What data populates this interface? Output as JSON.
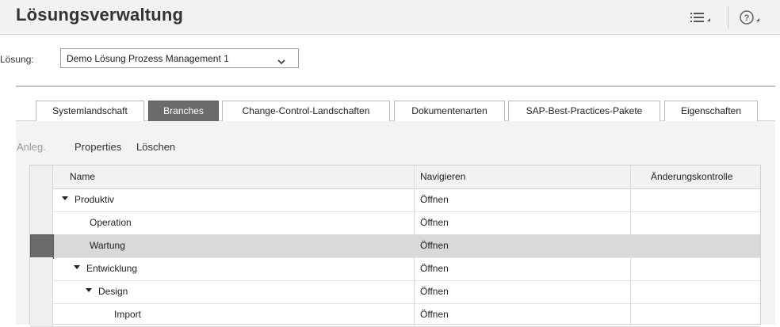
{
  "header": {
    "title": "Lösungsverwaltung"
  },
  "solution": {
    "label": "Lösung:",
    "selected": "Demo Lösung Prozess Management 1"
  },
  "tabs": [
    {
      "label": "Systemlandschaft",
      "active": false
    },
    {
      "label": "Branches",
      "active": true
    },
    {
      "label": "Change-Control-Landschaften",
      "active": false
    },
    {
      "label": "Dokumentenarten",
      "active": false
    },
    {
      "label": "SAP-Best-Practices-Pakete",
      "active": false
    },
    {
      "label": "Eigenschaften",
      "active": false
    }
  ],
  "toolbar": {
    "create": "Anleg.",
    "properties": "Properties",
    "delete": "Löschen"
  },
  "table": {
    "columns": [
      "Name",
      "Navigieren",
      "Änderungskontrolle"
    ],
    "rows": [
      {
        "name": "Produktiv",
        "level": 0,
        "expanded": true,
        "nav": "Öffnen",
        "change": "",
        "selected": false
      },
      {
        "name": "Operation",
        "level": 1,
        "expanded": false,
        "nav": "Öffnen",
        "change": "",
        "selected": false
      },
      {
        "name": "Wartung",
        "level": 1,
        "expanded": false,
        "nav": "Öffnen",
        "change": "",
        "selected": true
      },
      {
        "name": "Entwicklung",
        "level": 1,
        "expanded": true,
        "nav": "Öffnen",
        "change": "",
        "selected": false
      },
      {
        "name": "Design",
        "level": 2,
        "expanded": true,
        "nav": "Öffnen",
        "change": "",
        "selected": false
      },
      {
        "name": "Import",
        "level": 3,
        "expanded": false,
        "nav": "Öffnen",
        "change": "",
        "selected": false
      }
    ]
  }
}
